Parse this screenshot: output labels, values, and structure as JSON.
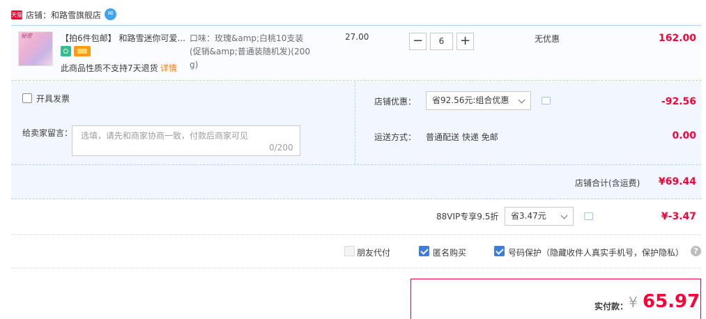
{
  "shop": {
    "badge": "天猫",
    "label": "店铺：和路雪旗舰店",
    "ww_icon": "chat-bubble-icon"
  },
  "item": {
    "thumb_text": "秘密",
    "title": "【拍6件包邮】 和路雪迷你可爱...",
    "no_return": "此商品性质不支持7天退货",
    "no_return_link": "详情",
    "sku_lines": [
      "口味：玫瑰&amp;白桃10支装",
      "(促销&amp;普通装随机发)(200",
      "g)"
    ],
    "unit_price": "27.00",
    "qty_minus": "−",
    "quantity": "6",
    "qty_plus": "+",
    "discount_text": "无优惠",
    "subtotal": "162.00"
  },
  "options": {
    "invoice_label": "开具发票",
    "message_label": "给卖家留言：",
    "message_placeholder": "选填，请先和商家协商一致，付款后商家可见",
    "message_count": "0/200",
    "shop_discount_label": "店铺优惠：",
    "shop_discount_selected": "省92.56元:组合优惠",
    "shop_discount_value": "-92.56",
    "shipping_label": "运送方式：",
    "shipping_value": "普通配送 快递 免邮",
    "shipping_fee": "0.00",
    "shop_total_label": "店铺合计(含运费)",
    "shop_total_value": "¥69.44"
  },
  "vip": {
    "label": "88VIP专享9.5折",
    "selected": "省3.47元",
    "value": "¥-3.47"
  },
  "privacy": {
    "friend_pay": "朋友代付",
    "anonymous": "匿名购买",
    "phone_protect": "号码保护（隐藏收件人真实手机号，保护隐私）",
    "help": "?"
  },
  "payment": {
    "label": "实付款：",
    "currency": "¥",
    "amount": "65.97"
  },
  "colors": {
    "price_red": "#ff0036",
    "link_orange": "#ff7c00",
    "panel_blue": "#f2f7ff",
    "checkbox_blue": "#3e7ce0"
  }
}
